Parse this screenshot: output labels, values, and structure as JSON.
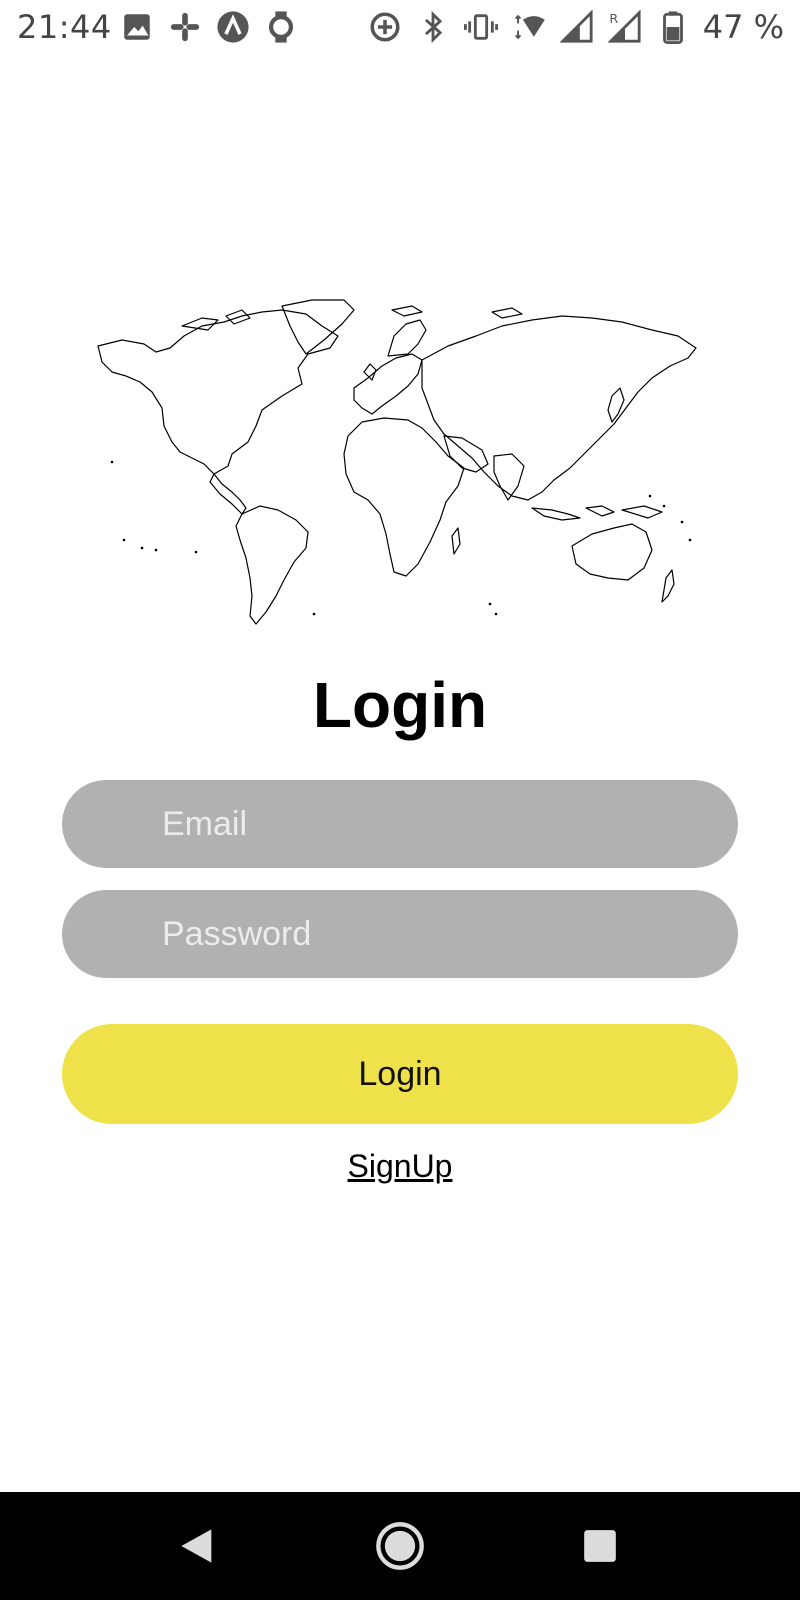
{
  "status_bar": {
    "time": "21:44",
    "battery_text": "47 %",
    "left_icons": [
      "image-icon",
      "slack-icon",
      "arc-icon",
      "watch-icon"
    ],
    "right_icons": [
      "data-saver-icon",
      "bluetooth-icon",
      "vibrate-icon",
      "wifi-icon",
      "signal-icon",
      "signal-roaming-icon",
      "battery-icon"
    ]
  },
  "title": "Login",
  "email": {
    "placeholder": "Email",
    "value": ""
  },
  "password": {
    "placeholder": "Password",
    "value": ""
  },
  "login_button": {
    "label": "Login"
  },
  "signup_link": {
    "label": "SignUp"
  },
  "colors": {
    "input_bg": "#b1b1b1",
    "button_bg": "#efe14a",
    "nav_bg": "#000000"
  },
  "nav": {
    "buttons": [
      "back-icon",
      "home-icon",
      "recents-icon"
    ]
  }
}
